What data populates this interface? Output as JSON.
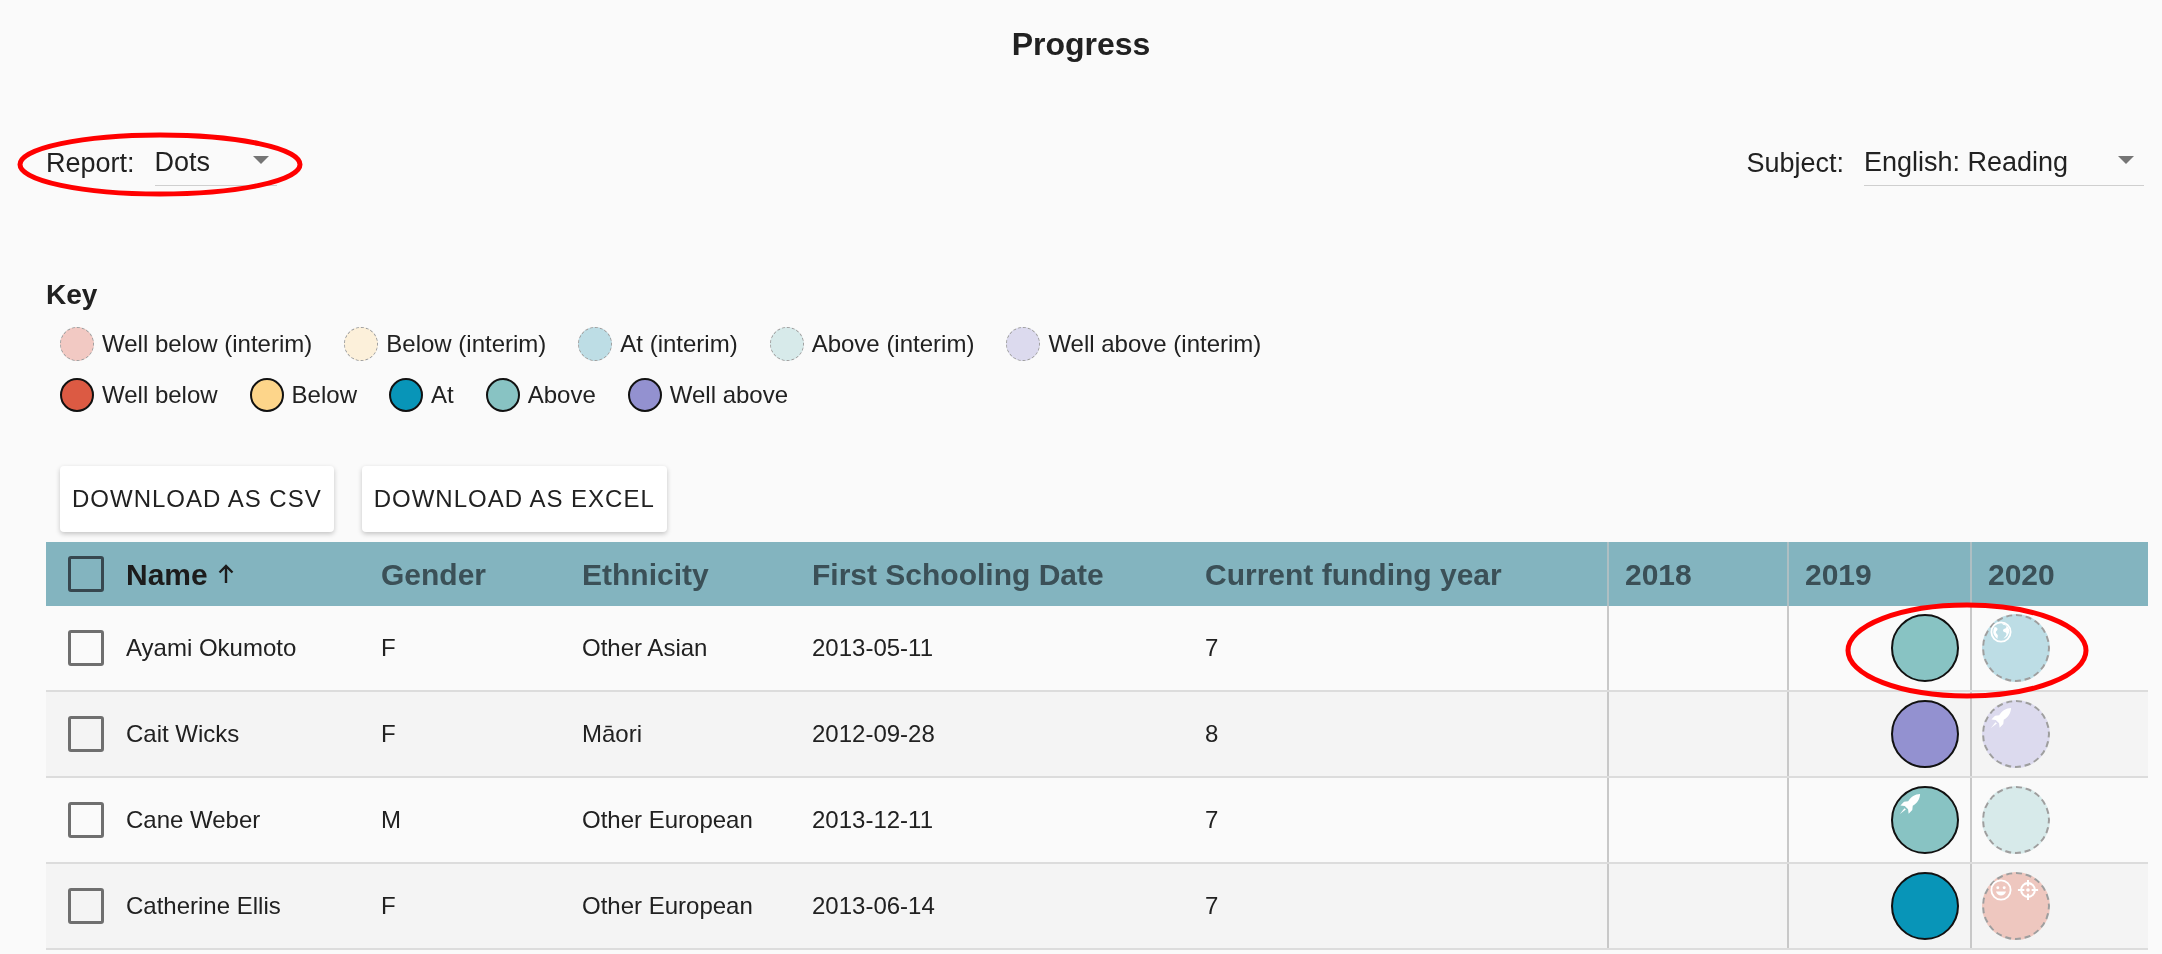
{
  "title": "Progress",
  "report": {
    "label": "Report:",
    "value": "Dots",
    "circled": true
  },
  "subject": {
    "label": "Subject:",
    "value": "English: Reading"
  },
  "key": {
    "title": "Key",
    "items": [
      {
        "label": "Well below (interim)",
        "kind": "interim",
        "color": "#f2c9c3"
      },
      {
        "label": "Below (interim)",
        "kind": "interim",
        "color": "#fcf0da"
      },
      {
        "label": "At (interim)",
        "kind": "interim",
        "color": "#bddde5"
      },
      {
        "label": "Above (interim)",
        "kind": "interim",
        "color": "#d7eaea"
      },
      {
        "label": "Well above (interim)",
        "kind": "interim",
        "color": "#dcdaee"
      },
      {
        "label": "Well below",
        "kind": "final",
        "color": "#dc5a43"
      },
      {
        "label": "Below",
        "kind": "final",
        "color": "#fdd58a"
      },
      {
        "label": "At",
        "kind": "final",
        "color": "#0895b8"
      },
      {
        "label": "Above",
        "kind": "final",
        "color": "#88c3c3"
      },
      {
        "label": "Well above",
        "kind": "final",
        "color": "#9391d0"
      }
    ]
  },
  "buttons": [
    "DOWNLOAD AS CSV",
    "DOWNLOAD AS EXCEL"
  ],
  "table": {
    "select_all": {
      "checked": false
    },
    "columns": [
      {
        "label": "Name",
        "kind": "text",
        "sorted": true
      },
      {
        "label": "Gender",
        "kind": "text",
        "sorted": false
      },
      {
        "label": "Ethnicity",
        "kind": "text",
        "sorted": false
      },
      {
        "label": "First Schooling Date",
        "kind": "text",
        "sorted": false
      },
      {
        "label": "Current funding year",
        "kind": "text",
        "sorted": false
      },
      {
        "label": "2018",
        "kind": "year",
        "sorted": false
      },
      {
        "label": "2019",
        "kind": "year",
        "sorted": false
      },
      {
        "label": "2020",
        "kind": "year",
        "sorted": false
      }
    ],
    "rows": [
      {
        "selected": false,
        "circled": true,
        "cells": [
          "Ayami Okumoto",
          "F",
          "Other Asian",
          "2013-05-11",
          "7"
        ],
        "results": {
          "year_2": {
            "second": {
              "kind": "final",
              "color": "#88c3c3"
            }
          },
          "year_3": {
            "first": {
              "kind": "interim",
              "color": "#bddde5",
              "badges": [
                {
                  "kind": "globe"
                }
              ]
            }
          }
        }
      },
      {
        "selected": false,
        "circled": false,
        "cells": [
          "Cait Wicks",
          "F",
          "Māori",
          "2012-09-28",
          "8"
        ],
        "results": {
          "year_2": {
            "second": {
              "kind": "final",
              "color": "#9391d0"
            }
          },
          "year_3": {
            "first": {
              "kind": "interim",
              "color": "#dcdaee",
              "badges": [
                {
                  "kind": "rocket"
                }
              ]
            }
          }
        }
      },
      {
        "selected": false,
        "circled": false,
        "cells": [
          "Cane Weber",
          "M",
          "Other European",
          "2013-12-11",
          "7"
        ],
        "results": {
          "year_2": {
            "second": {
              "kind": "final",
              "color": "#88c3c3",
              "badges": [
                {
                  "kind": "rocket"
                }
              ]
            }
          },
          "year_3": {
            "first": {
              "kind": "interim",
              "color": "#d7eaea"
            }
          }
        }
      },
      {
        "selected": false,
        "circled": false,
        "cells": [
          "Catherine Ellis",
          "F",
          "Other European",
          "2013-06-14",
          "7"
        ],
        "results": {
          "year_2": {
            "second": {
              "kind": "final",
              "color": "#0895b8"
            }
          },
          "year_3": {
            "first": {
              "kind": "interim",
              "color": "#eec7bf",
              "badges": [
                {
                  "kind": "smiley"
                },
                {
                  "kind": "crosshair"
                }
              ]
            }
          }
        }
      }
    ]
  }
}
